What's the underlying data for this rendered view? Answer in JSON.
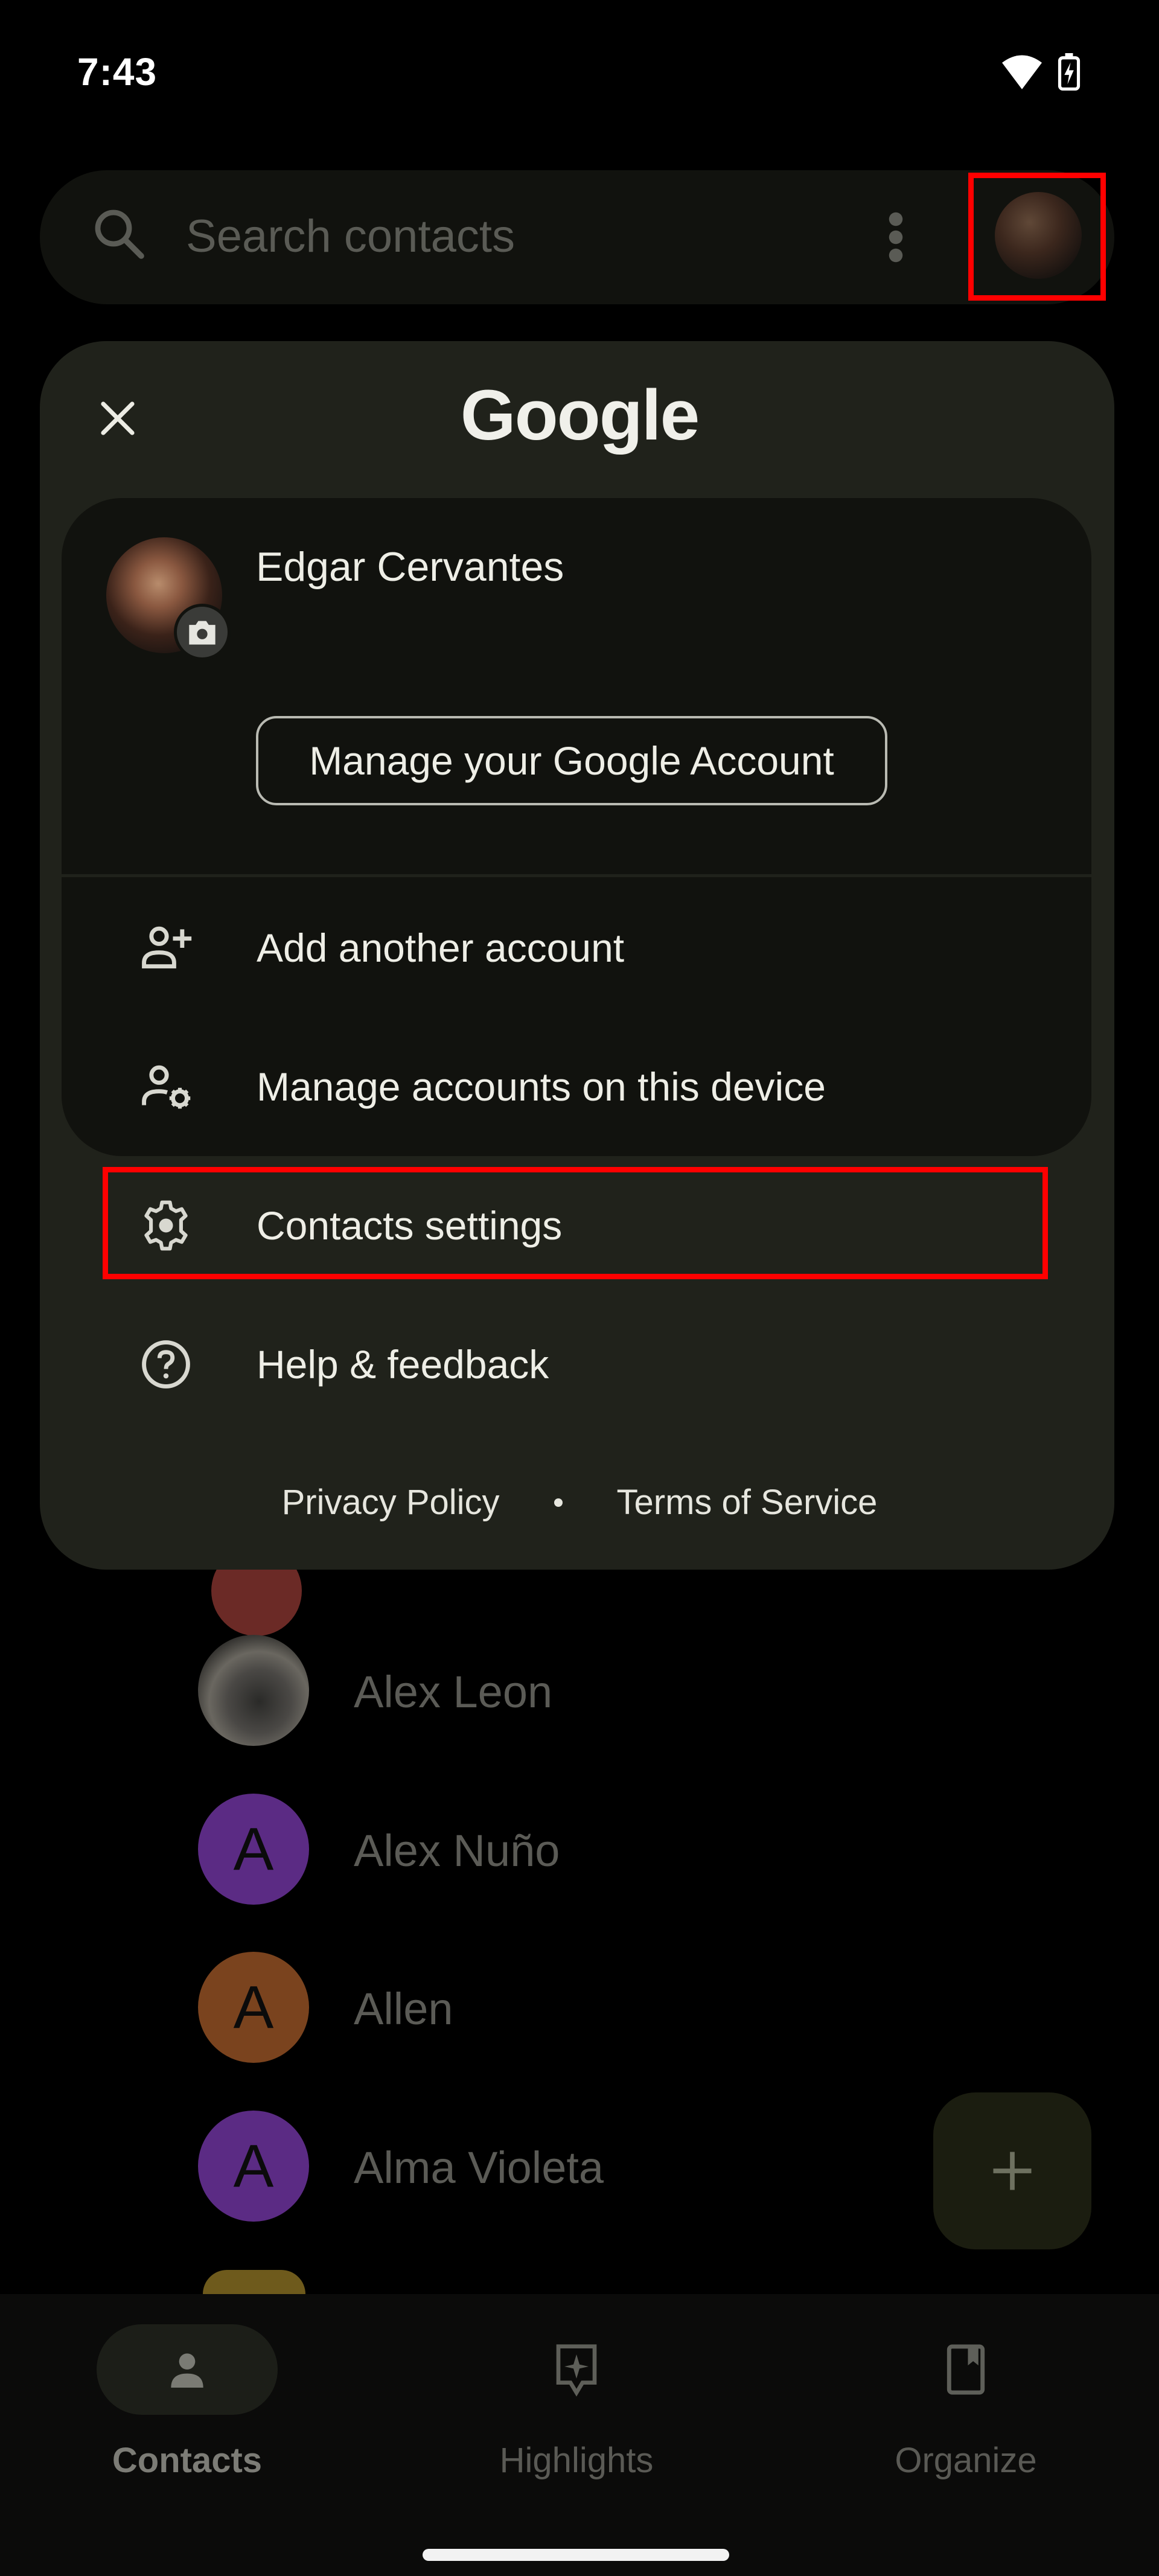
{
  "status_bar": {
    "time": "7:43",
    "icons": [
      "wifi-icon",
      "battery-charging-icon"
    ]
  },
  "search": {
    "placeholder": "Search contacts",
    "icons": [
      "search-icon",
      "more-vert-icon"
    ],
    "account_avatar": "account-avatar"
  },
  "contacts": [
    {
      "name": "Alex Leon",
      "avatar_type": "photo",
      "initial": "",
      "color": "#3a3a38"
    },
    {
      "name": "Alex Nuño",
      "avatar_type": "initial",
      "initial": "A",
      "color": "#5b2b84"
    },
    {
      "name": "Allen",
      "avatar_type": "initial",
      "initial": "A",
      "color": "#7a431e"
    },
    {
      "name": "Alma Violeta",
      "avatar_type": "initial",
      "initial": "A",
      "color": "#5b2b84"
    }
  ],
  "fab": {
    "icon": "plus-icon"
  },
  "bottom_nav": [
    {
      "label": "Contacts",
      "icon": "person-icon",
      "active": true
    },
    {
      "label": "Highlights",
      "icon": "highlights-icon",
      "active": false
    },
    {
      "label": "Organize",
      "icon": "bookmark-icon",
      "active": false
    }
  ],
  "dialog": {
    "title": "Google",
    "close_icon": "close-icon",
    "account": {
      "name": "Edgar Cervantes",
      "manage_button": "Manage your Google Account"
    },
    "account_actions": [
      {
        "label": "Add another account",
        "icon": "person-add-icon"
      },
      {
        "label": "Manage accounts on this device",
        "icon": "manage-accounts-icon"
      }
    ],
    "menu": [
      {
        "label": "Contacts settings",
        "icon": "gear-icon",
        "highlighted": true
      },
      {
        "label": "Help & feedback",
        "icon": "help-icon",
        "highlighted": false
      }
    ],
    "footer": {
      "privacy": "Privacy Policy",
      "separator": "•",
      "terms": "Terms of Service"
    }
  },
  "colors": {
    "dialog_bg": "#20221b",
    "card_bg": "#11120e",
    "highlight": "#ff0000",
    "text": "#eeeee6"
  }
}
